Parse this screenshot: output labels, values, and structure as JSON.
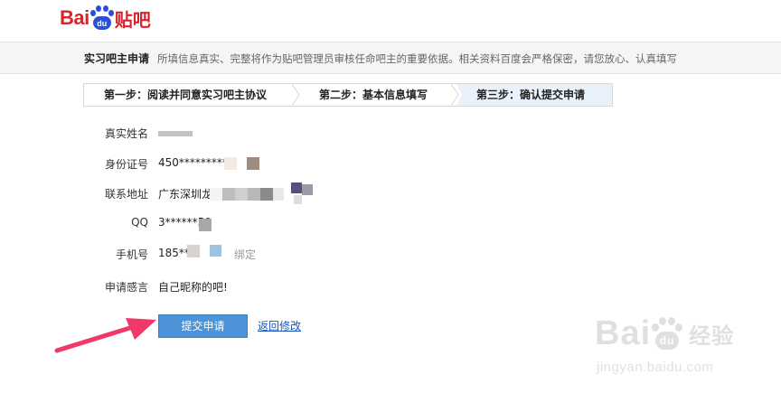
{
  "logo": {
    "text_latin": "Bai",
    "paw_text": "du",
    "text_cn": "贴吧"
  },
  "header": {
    "title": "实习吧主申请",
    "description": "所填信息真实、完整将作为贴吧管理员审核任命吧主的重要依据。相关资料百度会严格保密，请您放心、认真填写"
  },
  "steps": [
    {
      "label": "第一步：阅读并同意实习吧主协议",
      "active": false
    },
    {
      "label": "第二步：基本信息填写",
      "active": false
    },
    {
      "label": "第三步：确认提交申请",
      "active": true
    }
  ],
  "form": {
    "name": {
      "label": "真实姓名",
      "value": ""
    },
    "id_number": {
      "label": "身份证号",
      "value": "450**********"
    },
    "address": {
      "label": "联系地址",
      "value": "广东深圳龙"
    },
    "qq": {
      "label": "QQ",
      "value": "3******50"
    },
    "phone": {
      "label": "手机号",
      "value": "185**",
      "suffix": "绑定"
    },
    "statement": {
      "label": "申请感言",
      "value": "自己昵称的吧!"
    }
  },
  "actions": {
    "submit_label": "提交申请",
    "back_label": "返回修改"
  },
  "watermark": {
    "brand_latin_1": "Bai",
    "paw_text": "du",
    "brand_cn": "经验",
    "url": "jingyan.baidu.com"
  },
  "colors": {
    "brand_red": "#d9232d",
    "brand_blue": "#2b4fd8",
    "submit_blue": "#4d93d8",
    "arrow_pink": "#f0386b"
  }
}
